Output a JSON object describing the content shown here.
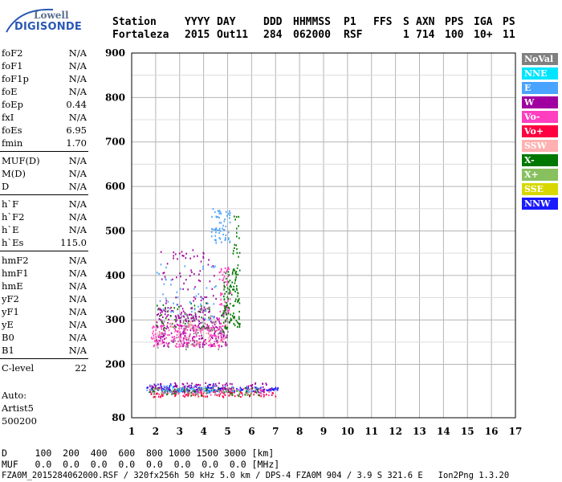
{
  "logo": {
    "line1": "Lowell",
    "line2": "DIGISONDE"
  },
  "header": {
    "labels": [
      "Station",
      "YYYY",
      "DAY",
      "DDD",
      "HHMMSS",
      "P1",
      "FFS",
      "S",
      "AXN",
      "PPS",
      "IGA",
      "PS"
    ],
    "values": [
      "Fortaleza",
      "2015",
      "Out11",
      "284",
      "062000",
      "RSF",
      "",
      "1",
      "714",
      "100",
      "10+",
      "11"
    ]
  },
  "params": [
    {
      "name": "foF2",
      "value": "N/A"
    },
    {
      "name": "foF1",
      "value": "N/A"
    },
    {
      "name": "foF1p",
      "value": "N/A"
    },
    {
      "name": "foE",
      "value": "N/A"
    },
    {
      "name": "foEp",
      "value": "0.44"
    },
    {
      "name": "fxI",
      "value": "N/A"
    },
    {
      "name": "foEs",
      "value": "6.95"
    },
    {
      "name": "fmin",
      "value": "1.70"
    },
    {
      "name": "MUF(D)",
      "value": "N/A"
    },
    {
      "name": "M(D)",
      "value": "N/A"
    },
    {
      "name": "D",
      "value": "N/A"
    },
    {
      "name": "h`F",
      "value": "N/A"
    },
    {
      "name": "h`F2",
      "value": "N/A"
    },
    {
      "name": "h`E",
      "value": "N/A"
    },
    {
      "name": "h`Es",
      "value": "115.0"
    },
    {
      "name": "hmF2",
      "value": "N/A"
    },
    {
      "name": "hmF1",
      "value": "N/A"
    },
    {
      "name": "hmE",
      "value": "N/A"
    },
    {
      "name": "yF2",
      "value": "N/A"
    },
    {
      "name": "yF1",
      "value": "N/A"
    },
    {
      "name": "yE",
      "value": "N/A"
    },
    {
      "name": "B0",
      "value": "N/A"
    },
    {
      "name": "B1",
      "value": "N/A"
    },
    {
      "name": "C-level",
      "value": "22"
    }
  ],
  "auto": {
    "line1": "Auto:",
    "line2": "Artist5",
    "line3": "500200"
  },
  "legend": [
    {
      "label": "NoVal",
      "bg": "#808080",
      "fg": "#ffffff"
    },
    {
      "label": "NNE",
      "bg": "#00e5ff",
      "fg": "#ffffff"
    },
    {
      "label": "E",
      "bg": "#4aa3ff",
      "fg": "#ffffff"
    },
    {
      "label": "W",
      "bg": "#a000a0",
      "fg": "#ffffff"
    },
    {
      "label": "Vo-",
      "bg": "#ff3fbf",
      "fg": "#ffffff"
    },
    {
      "label": "Vo+",
      "bg": "#ff0040",
      "fg": "#ffffff"
    },
    {
      "label": "SSW",
      "bg": "#ffb0b0",
      "fg": "#ffffff"
    },
    {
      "label": "X-",
      "bg": "#007700",
      "fg": "#ffffff"
    },
    {
      "label": "X+",
      "bg": "#88c060",
      "fg": "#ffffff"
    },
    {
      "label": "SSE",
      "bg": "#d8d800",
      "fg": "#ffffff"
    },
    {
      "label": "NNW",
      "bg": "#1a1aff",
      "fg": "#ffffff"
    }
  ],
  "footer": {
    "d_row": "D     100  200  400  600  800 1000 1500 3000 [km]",
    "muf_row": "MUF   0.0  0.0  0.0  0.0  0.0  0.0  0.0  0.0 [MHz]",
    "info": "FZA0M_2015284062000.RSF / 320fx256h 50 kHz 5.0 km / DPS-4 FZA0M 904 / 3.9 S 321.6 E   Ion2Png 1.3.20"
  },
  "chart_data": {
    "type": "scatter",
    "title": "",
    "xlabel": "",
    "ylabel": "",
    "xlim": [
      1,
      17
    ],
    "ylim": [
      80,
      900
    ],
    "x_ticks": [
      1,
      2,
      3,
      4,
      5,
      6,
      7,
      8,
      9,
      10,
      11,
      12,
      13,
      14,
      15,
      16,
      17
    ],
    "y_ticks": [
      80,
      200,
      300,
      400,
      500,
      600,
      700,
      800,
      900
    ],
    "grid": true,
    "legend_position": "right",
    "series": [
      {
        "name": "NNW",
        "color": "#1a1aff",
        "regions": [
          {
            "x": [
              1.6,
              7.1
            ],
            "y": [
              140,
              150
            ],
            "density": 0.9
          },
          {
            "x": [
              1.8,
              4.5
            ],
            "y": [
              150,
              158
            ],
            "density": 0.3
          }
        ]
      },
      {
        "name": "W",
        "color": "#a000a0",
        "regions": [
          {
            "x": [
              1.7,
              6.8
            ],
            "y": [
              138,
              160
            ],
            "density": 0.4
          },
          {
            "x": [
              2.0,
              5.0
            ],
            "y": [
              240,
              330
            ],
            "density": 0.35
          },
          {
            "x": [
              2.2,
              4.5
            ],
            "y": [
              330,
              460
            ],
            "density": 0.08
          }
        ]
      },
      {
        "name": "Vo-",
        "color": "#ff3fbf",
        "regions": [
          {
            "x": [
              1.8,
              4.9
            ],
            "y": [
              240,
              290
            ],
            "density": 0.5
          },
          {
            "x": [
              4.6,
              5.1
            ],
            "y": [
              290,
              420
            ],
            "density": 0.3
          },
          {
            "x": [
              1.7,
              6.8
            ],
            "y": [
              132,
              148
            ],
            "density": 0.3
          }
        ]
      },
      {
        "name": "Vo+",
        "color": "#ff0040",
        "regions": [
          {
            "x": [
              1.7,
              7.0
            ],
            "y": [
              128,
              140
            ],
            "density": 0.45
          }
        ]
      },
      {
        "name": "X-",
        "color": "#007700",
        "regions": [
          {
            "x": [
              4.8,
              5.5
            ],
            "y": [
              280,
              420
            ],
            "density": 0.4
          },
          {
            "x": [
              5.2,
              5.5
            ],
            "y": [
              400,
              540
            ],
            "density": 0.2
          },
          {
            "x": [
              2.0,
              5.0
            ],
            "y": [
              275,
              340
            ],
            "density": 0.08
          },
          {
            "x": [
              1.7,
              6.5
            ],
            "y": [
              130,
              150
            ],
            "density": 0.2
          }
        ]
      },
      {
        "name": "E",
        "color": "#4aa3ff",
        "regions": [
          {
            "x": [
              4.3,
              5.1
            ],
            "y": [
              475,
              555
            ],
            "density": 0.35
          },
          {
            "x": [
              1.6,
              6.5
            ],
            "y": [
              140,
              155
            ],
            "density": 0.15
          },
          {
            "x": [
              2.0,
              4.5
            ],
            "y": [
              290,
              430
            ],
            "density": 0.05
          }
        ]
      },
      {
        "name": "NNE",
        "color": "#00e5ff",
        "regions": [
          {
            "x": [
              1.8,
              6.0
            ],
            "y": [
              138,
              152
            ],
            "density": 0.12
          }
        ]
      },
      {
        "name": "X+",
        "color": "#88c060",
        "regions": [
          {
            "x": [
              1.7,
              6.5
            ],
            "y": [
              132,
              148
            ],
            "density": 0.15
          }
        ]
      },
      {
        "name": "SSW",
        "color": "#ffb0b0",
        "regions": [
          {
            "x": [
              1.8,
              5.0
            ],
            "y": [
              240,
              300
            ],
            "density": 0.1
          }
        ]
      },
      {
        "name": "NoVal",
        "color": "#808080",
        "regions": [
          {
            "x": [
              2.0,
              5.0
            ],
            "y": [
              235,
              330
            ],
            "density": 0.1
          },
          {
            "x": [
              1.7,
              6.5
            ],
            "y": [
              135,
              150
            ],
            "density": 0.1
          }
        ]
      }
    ]
  }
}
